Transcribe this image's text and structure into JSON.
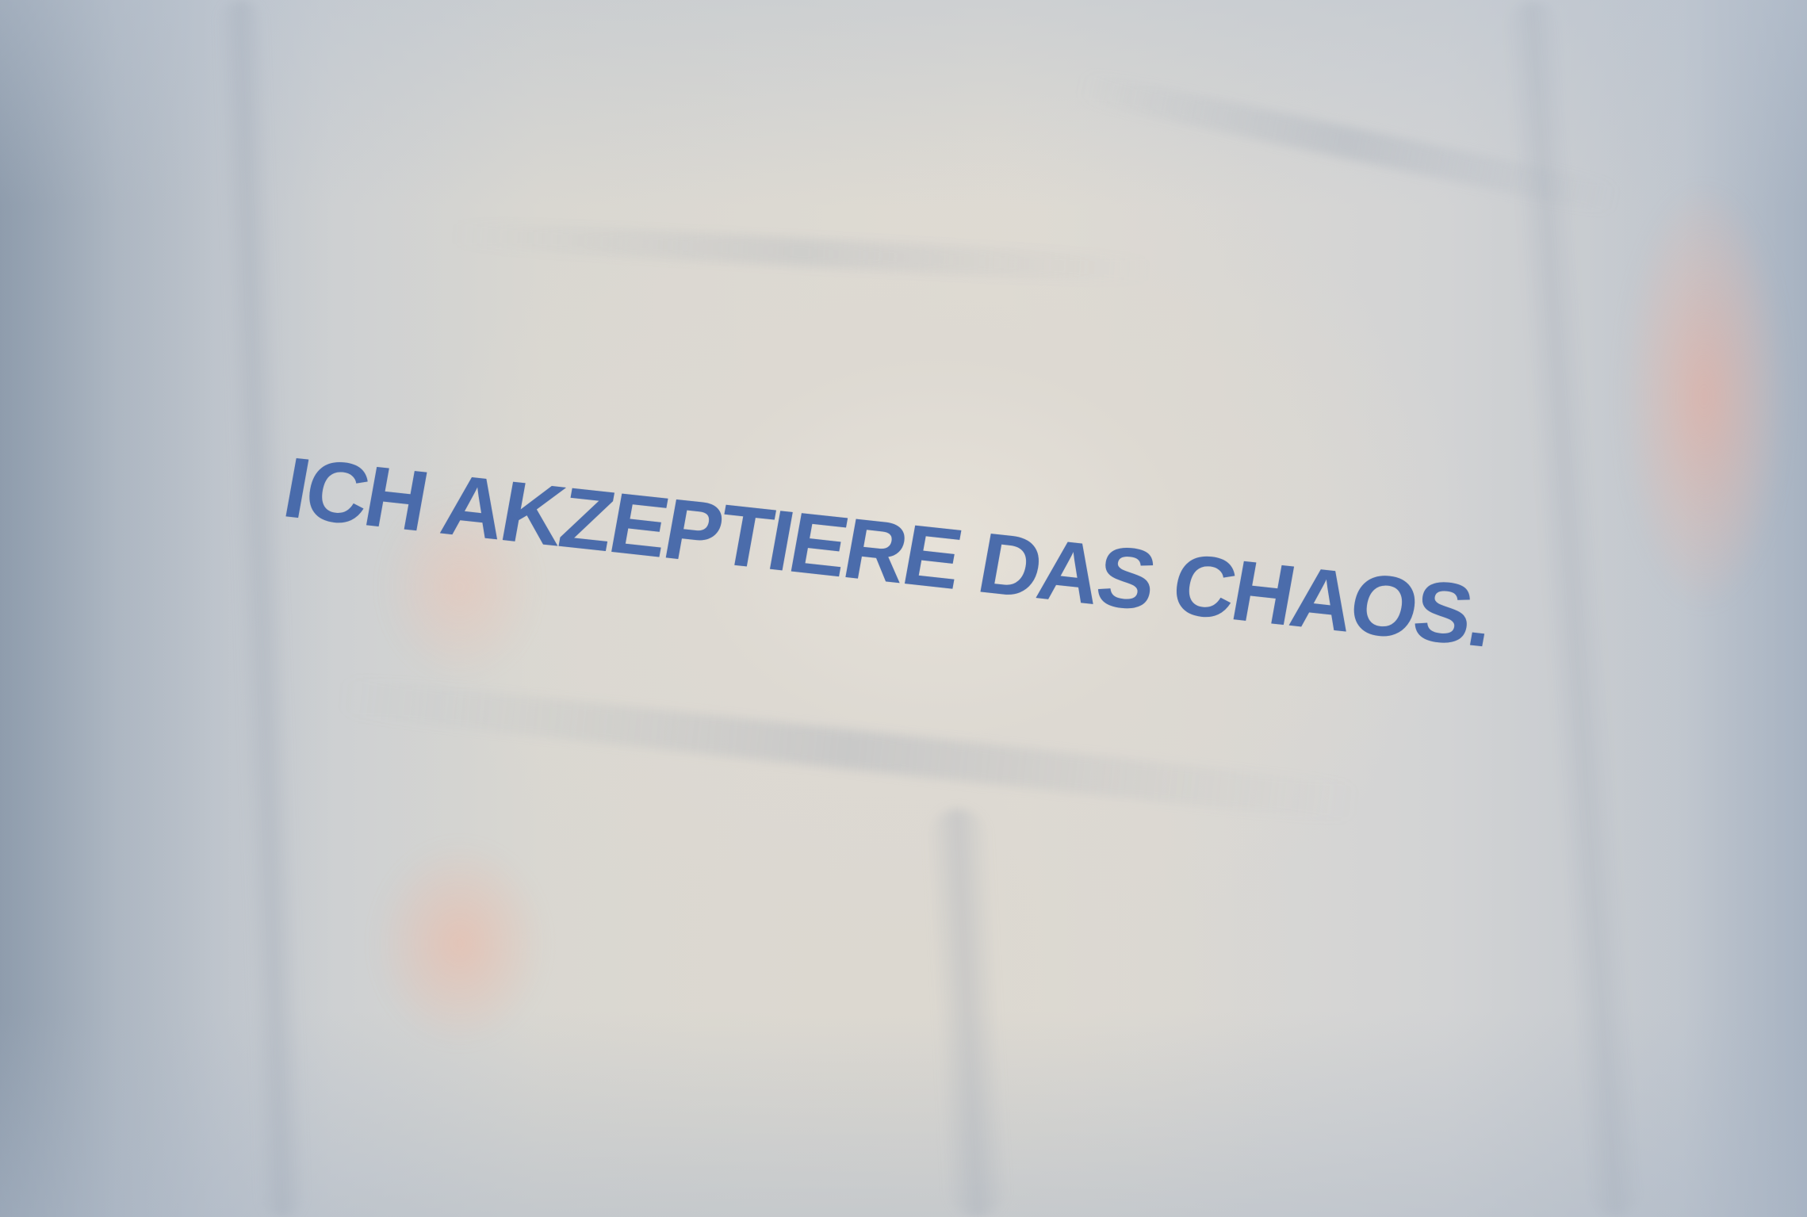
{
  "shirt_print": {
    "text": "ICH AKZEPTIERE DAS CHAOS."
  },
  "colors": {
    "print_color": "#3f63a8",
    "fabric_color": "#dfdbd3"
  }
}
